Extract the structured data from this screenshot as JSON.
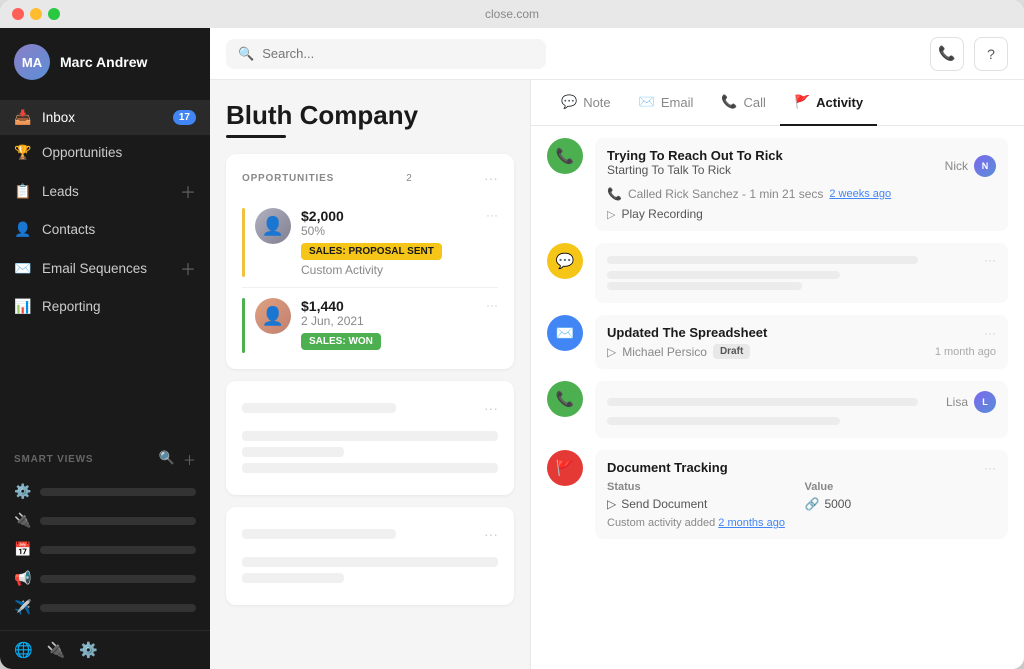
{
  "window": {
    "title": "close.com"
  },
  "sidebar": {
    "user": {
      "name": "Marc Andrew"
    },
    "nav_items": [
      {
        "id": "inbox",
        "label": "Inbox",
        "icon": "📥",
        "badge": "17"
      },
      {
        "id": "opportunities",
        "label": "Opportunities",
        "icon": "🏆",
        "badge": null
      },
      {
        "id": "leads",
        "label": "Leads",
        "icon": "📋",
        "badge": null,
        "add": true
      },
      {
        "id": "contacts",
        "label": "Contacts",
        "icon": "👤",
        "badge": null
      },
      {
        "id": "email-sequences",
        "label": "Email Sequences",
        "icon": "✉️",
        "badge": null,
        "add": true
      },
      {
        "id": "reporting",
        "label": "Reporting",
        "icon": "📊",
        "badge": null
      }
    ],
    "smart_views_label": "SMART VIEWS",
    "smart_views": [
      {
        "icon": "⚙️"
      },
      {
        "icon": "🔌"
      },
      {
        "icon": "📅"
      },
      {
        "icon": "📢"
      },
      {
        "icon": "✈️"
      }
    ],
    "bottom_icons": [
      "🌐",
      "🔌",
      "⚙️"
    ]
  },
  "topbar": {
    "search_placeholder": "Search...",
    "phone_icon": "📞",
    "help_icon": "?"
  },
  "main": {
    "company": {
      "name": "Bluth Company"
    },
    "left_panel": {
      "opportunities_label": "OPPORTUNITIES",
      "opportunities_count": "2",
      "opportunities": [
        {
          "amount": "$2,000",
          "percent": "50%",
          "tag": "SALES: PROPOSAL SENT",
          "tag_color": "yellow",
          "activity": "Custom Activity",
          "gender": "m"
        },
        {
          "amount": "$1,440",
          "date": "2 Jun, 2021",
          "tag": "SALES: WON",
          "tag_color": "green",
          "gender": "f"
        }
      ]
    },
    "tabs": [
      {
        "id": "note",
        "label": "Note",
        "icon": "💬",
        "active": false
      },
      {
        "id": "email",
        "label": "Email",
        "icon": "✉️",
        "active": false
      },
      {
        "id": "call",
        "label": "Call",
        "icon": "📞",
        "active": false
      },
      {
        "id": "activity",
        "label": "Activity",
        "icon": "🚩",
        "active": true
      }
    ],
    "activity_feed": [
      {
        "type": "call",
        "icon_color": "green",
        "title": "Trying To Reach Out To Rick",
        "subtitle": "Starting To Talk To Rick",
        "meta_icon": "📞",
        "meta": "Called Rick Sanchez - 1 min 21 secs",
        "meta_link": "2 weeks ago",
        "play_label": "Play Recording",
        "user_name": "Nick",
        "has_avatar": true,
        "avatar_initials": "N"
      },
      {
        "type": "custom",
        "icon_color": "yellow",
        "placeholder": true
      },
      {
        "type": "email",
        "icon_color": "blue",
        "title": "Updated The Spreadsheet",
        "user_name": "Michael Persico",
        "draft_badge": "Draft",
        "time": "1 month ago"
      },
      {
        "type": "call2",
        "icon_color": "green",
        "placeholder": true,
        "user_name": "Lisa",
        "has_avatar": true,
        "avatar_initials": "L"
      },
      {
        "type": "document",
        "icon_color": "red",
        "title": "Document Tracking",
        "status_label": "Status",
        "value_label": "Value",
        "send_label": "Send Document",
        "value": "5000",
        "footer": "Custom activity added",
        "footer_link": "2 months ago"
      }
    ]
  }
}
